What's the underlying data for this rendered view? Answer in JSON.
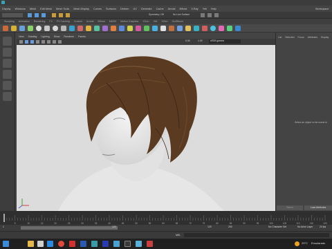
{
  "menubar": {
    "items": [
      "Display",
      "Windows",
      "Mesh",
      "Edit Mesh",
      "Mesh Tools",
      "Mesh Display",
      "Curves",
      "Surfaces",
      "Deform",
      "UV",
      "Generate",
      "Cache",
      "Arnold",
      "Bifrost",
      "V-Ray",
      "Yeti",
      "Help"
    ],
    "workspace": "Workspace:"
  },
  "statusline": {
    "symmetry": "Symmetry: Off",
    "live_surface": "No Live Surface"
  },
  "shelf": {
    "tabs": [
      "Sculpting",
      "Animation",
      "Rendering",
      "FX",
      "FX Caching",
      "Custom",
      "Arnold",
      "Bifrost",
      "MASH",
      "Motion Graphics",
      "XGen",
      "Yeti",
      "XGen",
      "GoZBrush"
    ]
  },
  "viewport": {
    "menus": [
      "View",
      "Shading",
      "Lighting",
      "Show",
      "Renderer",
      "Panels"
    ],
    "exposure": "0.00",
    "gamma": "1.00",
    "colorspace": "sRGB gamma"
  },
  "right_panel": {
    "tabs": [
      "List",
      "Selected",
      "Focus",
      "Attributes",
      "Display"
    ],
    "message": "Select an object in the scene to",
    "buttons": [
      "Select",
      "Load Attributes"
    ]
  },
  "timeline": {
    "ticks": [
      "5",
      "10",
      "15",
      "20",
      "25",
      "30",
      "35",
      "40",
      "45",
      "50",
      "55",
      "60",
      "65",
      "70",
      "75",
      "80",
      "85",
      "90",
      "95",
      "100",
      "105",
      "110",
      "115",
      "120"
    ]
  },
  "range": {
    "start": "1",
    "end": "120",
    "max_start": "120",
    "max_end": "200",
    "character_set": "No Character Set",
    "anim_layer": "No Anim Layer",
    "fps": "24 fps"
  },
  "cmdline": {
    "mel": "MEL"
  },
  "taskbar": {
    "temperature": "29°C",
    "weather": "Ensolarado"
  },
  "colors": {
    "hair": "#5a3b22",
    "viewport": "#dcdcdc",
    "accent": "#5a9ad8"
  }
}
